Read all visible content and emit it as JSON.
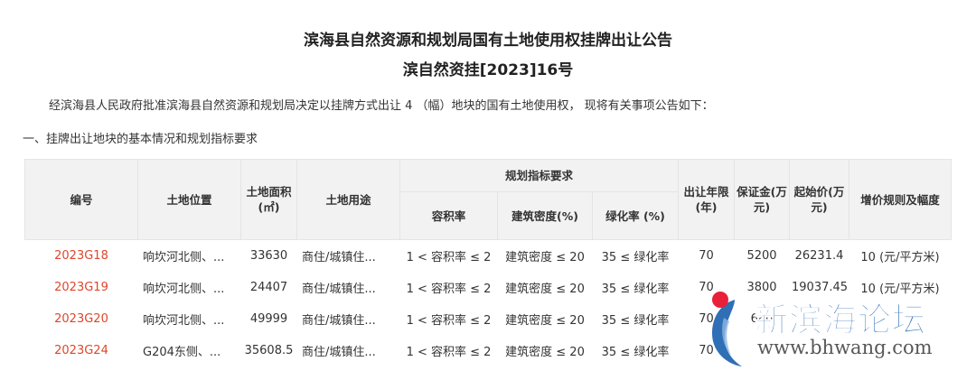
{
  "title_line1": "滨海县自然资源和规划局国有土地使用权挂牌出让公告",
  "title_line2": "滨自然资挂[2023]16号",
  "intro": "经滨海县人民政府批准滨海县自然资源和规划局决定以挂牌方式出让 4 （幅）地块的国有土地使用权， 现将有关事项公告如下：",
  "section_heading": "一、挂牌出让地块的基本情况和规划指标要求",
  "table": {
    "headers": {
      "code": "编号",
      "location": "土地位置",
      "area": "土地面积(㎡)",
      "use": "土地用途",
      "planning_group": "规划指标要求",
      "far": "容积率",
      "density": "建筑密度(%)",
      "green": "绿化率 (%)",
      "term": "出让年限(年)",
      "deposit": "保证金(万元)",
      "start_price": "起始价(万元)",
      "increment": "增价规则及幅度"
    },
    "rows": [
      {
        "code": "2023G18",
        "location": "响坎河北侧、...",
        "area": "33630",
        "use": "商住/城镇住...",
        "far": "1 < 容积率 ≤ 2",
        "density": "建筑密度 ≤ 20",
        "green": "35 ≤ 绿化率",
        "term": "70",
        "deposit": "5200",
        "start_price": "26231.4",
        "increment": "10 (元/平方米)"
      },
      {
        "code": "2023G19",
        "location": "响坎河北侧、...",
        "area": "24407",
        "use": "商住/城镇住...",
        "far": "1 < 容积率 ≤ 2",
        "density": "建筑密度 ≤ 20",
        "green": "35 ≤ 绿化率",
        "term": "70",
        "deposit": "3800",
        "start_price": "19037.45",
        "increment": "10 (元/平方米)"
      },
      {
        "code": "2023G20",
        "location": "响坎河北侧、...",
        "area": "49999",
        "use": "商住/城镇住...",
        "far": "1 < 容积率 ≤ 2",
        "density": "建筑密度 ≤ 20",
        "green": "35 ≤ 绿化率",
        "term": "70",
        "deposit": "680",
        "start_price": "",
        "increment": ""
      },
      {
        "code": "2023G24",
        "location": "G204东侧、...",
        "area": "35608.5",
        "use": "商住/城镇住...",
        "far": "1 < 容积率 ≤ 2",
        "density": "建筑密度 ≤ 20",
        "green": "35 ≤ 绿化率",
        "term": "70",
        "deposit": "",
        "start_price": "",
        "increment": ""
      }
    ]
  },
  "watermark": {
    "text": "新滨海论坛",
    "url": "www.bhwang.com",
    "colors": {
      "blue": "#2f6fb5",
      "red": "#e8203a"
    }
  }
}
